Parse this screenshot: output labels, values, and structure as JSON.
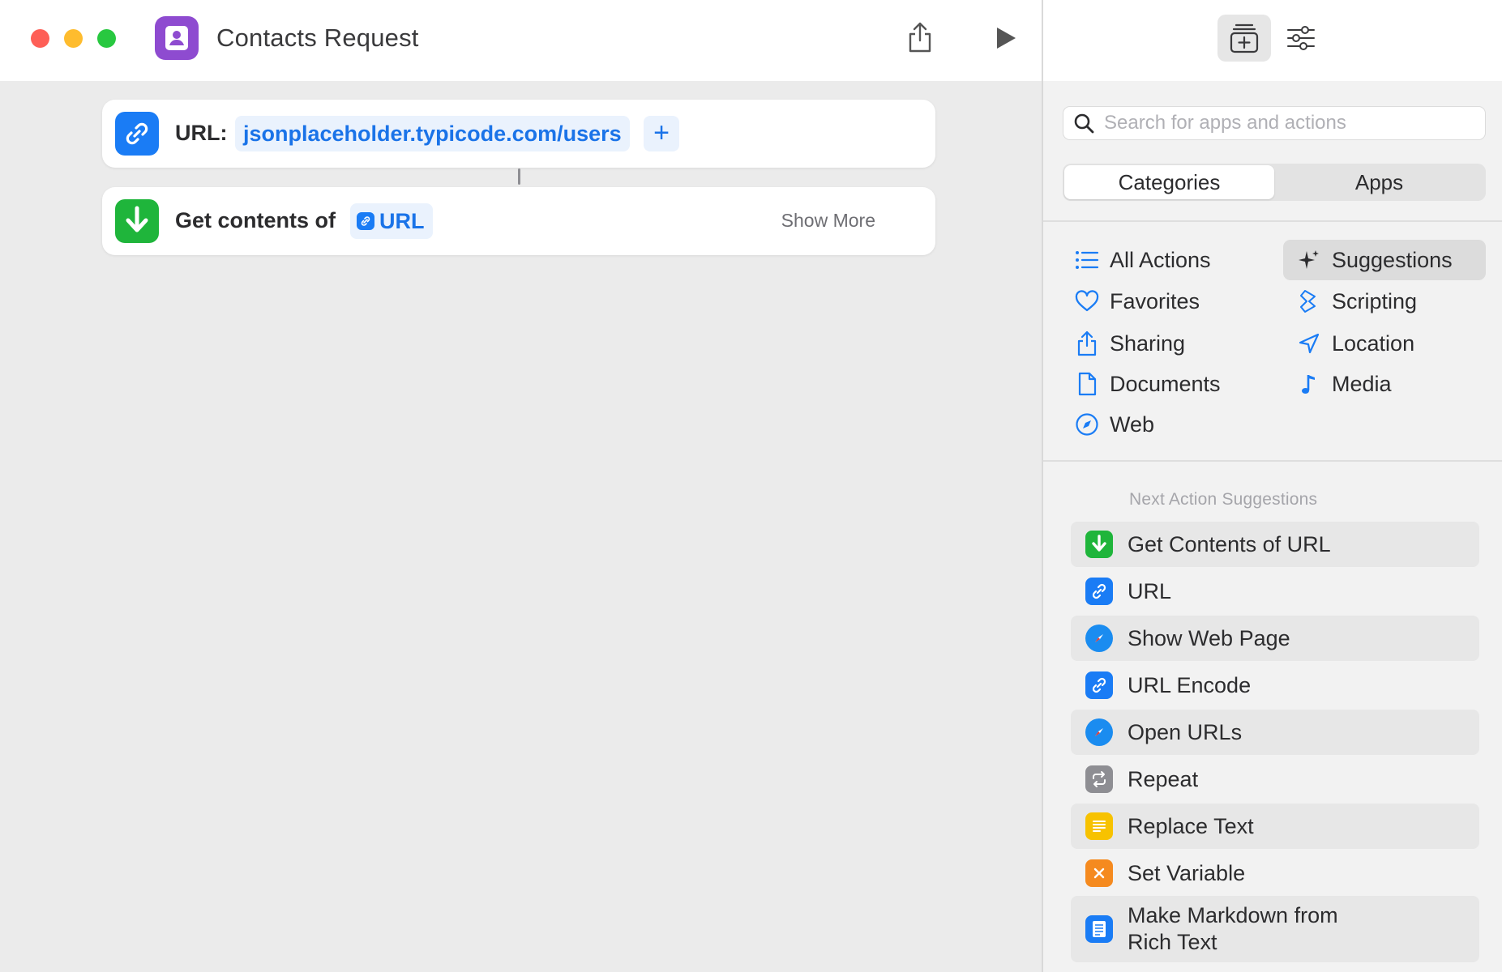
{
  "window": {
    "title": "Contacts Request"
  },
  "editor": {
    "url_action": {
      "label": "URL:",
      "value": "jsonplaceholder.typicode.com/users",
      "add_symbol": "+"
    },
    "get_action": {
      "label": "Get contents of",
      "variable": "URL",
      "show_more": "Show More"
    }
  },
  "sidebar": {
    "search_placeholder": "Search for apps and actions",
    "segments": [
      "Categories",
      "Apps"
    ],
    "categories_left": [
      {
        "label": "All Actions",
        "icon": "list-icon"
      },
      {
        "label": "Favorites",
        "icon": "heart-icon"
      },
      {
        "label": "Sharing",
        "icon": "share-icon"
      },
      {
        "label": "Documents",
        "icon": "document-icon"
      },
      {
        "label": "Web",
        "icon": "compass-icon"
      }
    ],
    "categories_right": [
      {
        "label": "Suggestions",
        "icon": "sparkles-icon",
        "selected": true
      },
      {
        "label": "Scripting",
        "icon": "scripting-icon"
      },
      {
        "label": "Location",
        "icon": "location-arrow-icon"
      },
      {
        "label": "Media",
        "icon": "music-note-icon"
      }
    ],
    "suggestions_heading": "Next Action Suggestions",
    "suggestions": [
      {
        "label": "Get Contents of URL",
        "icon": "download-arrow-icon",
        "color": "#1fb53b"
      },
      {
        "label": "URL",
        "icon": "link-icon",
        "color": "#1a7cf5"
      },
      {
        "label": "Show Web Page",
        "icon": "safari-icon",
        "color": "#1a8cf0"
      },
      {
        "label": "URL Encode",
        "icon": "link-icon",
        "color": "#1a7cf5"
      },
      {
        "label": "Open URLs",
        "icon": "safari-icon",
        "color": "#1a8cf0"
      },
      {
        "label": "Repeat",
        "icon": "repeat-icon",
        "color": "#8e8e93"
      },
      {
        "label": "Replace Text",
        "icon": "text-icon",
        "color": "#f7c200"
      },
      {
        "label": "Set Variable",
        "icon": "variable-icon",
        "color": "#f58a1f"
      },
      {
        "label_line1": "Make Markdown from",
        "label_line2": "Rich Text",
        "icon": "document-lines-icon",
        "color": "#1a7cf5"
      }
    ]
  },
  "colors": {
    "accent": "#1a73e8",
    "app_icon": "#8e4bd0",
    "close": "#fe5f57",
    "minimize": "#febc2e",
    "zoom": "#28c840"
  }
}
